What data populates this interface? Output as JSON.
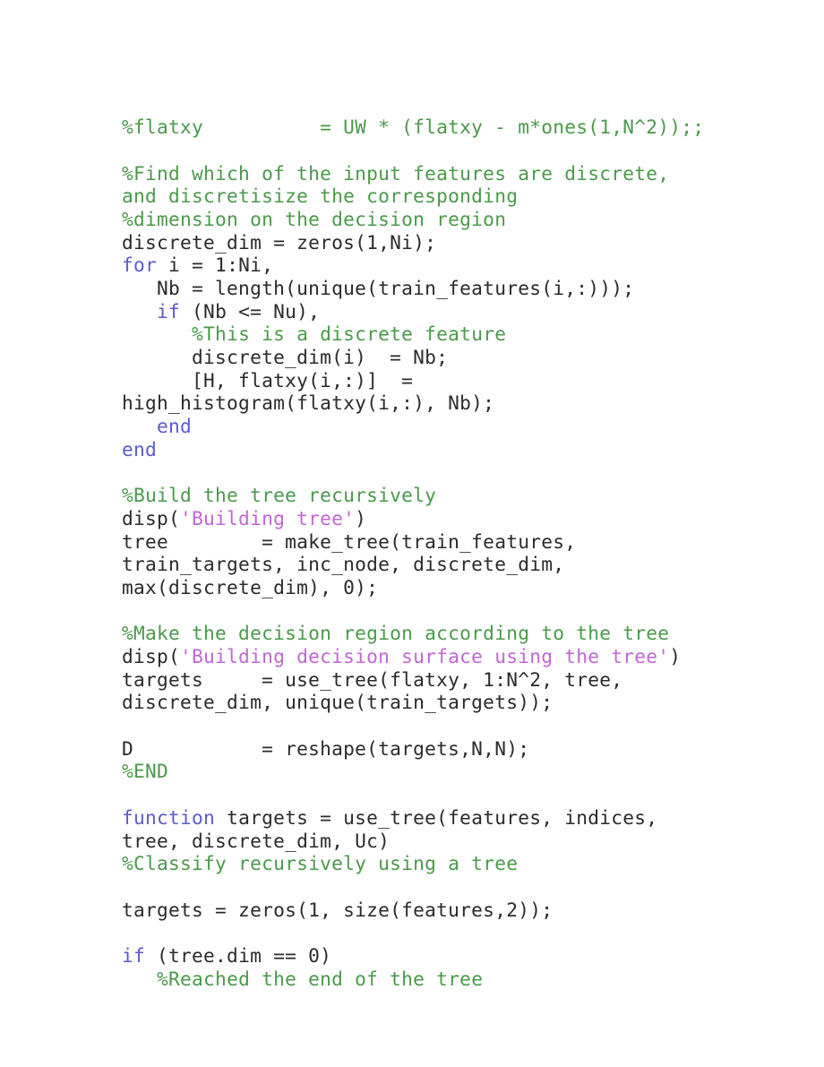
{
  "document": {
    "kind": "source-code-listing",
    "language": "MATLAB",
    "background_color": "#ffffff"
  },
  "theme": {
    "plain_color": "#2b2b2b",
    "comment_color": "#4a9a4a",
    "keyword_color": "#5b5bd0",
    "string_color": "#c266d6"
  },
  "code": {
    "lines": [
      {
        "id": 1,
        "segments": [
          {
            "type": "comment",
            "text": "%flatxy          = UW * (flatxy - m*ones(1,N^2));;"
          }
        ]
      },
      {
        "id": 2,
        "segments": [
          {
            "type": "plain",
            "text": ""
          }
        ]
      },
      {
        "id": 3,
        "segments": [
          {
            "type": "comment",
            "text": "%Find which of the input features are discrete,"
          }
        ]
      },
      {
        "id": 4,
        "segments": [
          {
            "type": "comment",
            "text": "and discretisize the corresponding"
          }
        ]
      },
      {
        "id": 5,
        "segments": [
          {
            "type": "comment",
            "text": "%dimension on the decision region"
          }
        ]
      },
      {
        "id": 6,
        "segments": [
          {
            "type": "plain",
            "text": "discrete_dim = zeros(1,Ni);"
          }
        ]
      },
      {
        "id": 7,
        "segments": [
          {
            "type": "keyword",
            "text": "for"
          },
          {
            "type": "plain",
            "text": " i = 1:Ni,"
          }
        ]
      },
      {
        "id": 8,
        "segments": [
          {
            "type": "plain",
            "text": "   Nb = length(unique(train_features(i,:)));"
          }
        ]
      },
      {
        "id": 9,
        "segments": [
          {
            "type": "plain",
            "text": "   "
          },
          {
            "type": "keyword",
            "text": "if"
          },
          {
            "type": "plain",
            "text": " (Nb <= Nu),"
          }
        ]
      },
      {
        "id": 10,
        "segments": [
          {
            "type": "plain",
            "text": "      "
          },
          {
            "type": "comment",
            "text": "%This is a discrete feature"
          }
        ]
      },
      {
        "id": 11,
        "segments": [
          {
            "type": "plain",
            "text": "      discrete_dim(i)  = Nb;"
          }
        ]
      },
      {
        "id": 12,
        "segments": [
          {
            "type": "plain",
            "text": "      [H, flatxy(i,:)]  ="
          }
        ]
      },
      {
        "id": 13,
        "segments": [
          {
            "type": "plain",
            "text": "high_histogram(flatxy(i,:), Nb);"
          }
        ]
      },
      {
        "id": 14,
        "segments": [
          {
            "type": "plain",
            "text": "   "
          },
          {
            "type": "keyword",
            "text": "end"
          }
        ]
      },
      {
        "id": 15,
        "segments": [
          {
            "type": "keyword",
            "text": "end"
          }
        ]
      },
      {
        "id": 16,
        "segments": [
          {
            "type": "plain",
            "text": ""
          }
        ]
      },
      {
        "id": 17,
        "segments": [
          {
            "type": "comment",
            "text": "%Build the tree recursively"
          }
        ]
      },
      {
        "id": 18,
        "segments": [
          {
            "type": "plain",
            "text": "disp("
          },
          {
            "type": "string",
            "text": "'Building tree'"
          },
          {
            "type": "plain",
            "text": ")"
          }
        ]
      },
      {
        "id": 19,
        "segments": [
          {
            "type": "plain",
            "text": "tree        = make_tree(train_features,"
          }
        ]
      },
      {
        "id": 20,
        "segments": [
          {
            "type": "plain",
            "text": "train_targets, inc_node, discrete_dim,"
          }
        ]
      },
      {
        "id": 21,
        "segments": [
          {
            "type": "plain",
            "text": "max(discrete_dim), 0);"
          }
        ]
      },
      {
        "id": 22,
        "segments": [
          {
            "type": "plain",
            "text": ""
          }
        ]
      },
      {
        "id": 23,
        "segments": [
          {
            "type": "comment",
            "text": "%Make the decision region according to the tree"
          }
        ]
      },
      {
        "id": 24,
        "segments": [
          {
            "type": "plain",
            "text": "disp("
          },
          {
            "type": "string",
            "text": "'Building decision surface using the tree'"
          },
          {
            "type": "plain",
            "text": ")"
          }
        ]
      },
      {
        "id": 25,
        "segments": [
          {
            "type": "plain",
            "text": "targets     = use_tree(flatxy, 1:N^2, tree,"
          }
        ]
      },
      {
        "id": 26,
        "segments": [
          {
            "type": "plain",
            "text": "discrete_dim, unique(train_targets));"
          }
        ]
      },
      {
        "id": 27,
        "segments": [
          {
            "type": "plain",
            "text": ""
          }
        ]
      },
      {
        "id": 28,
        "segments": [
          {
            "type": "plain",
            "text": "D           = reshape(targets,N,N);"
          }
        ]
      },
      {
        "id": 29,
        "segments": [
          {
            "type": "comment",
            "text": "%END"
          }
        ]
      },
      {
        "id": 30,
        "segments": [
          {
            "type": "plain",
            "text": ""
          }
        ]
      },
      {
        "id": 31,
        "segments": [
          {
            "type": "keyword",
            "text": "function"
          },
          {
            "type": "plain",
            "text": " targets = use_tree(features, indices,"
          }
        ]
      },
      {
        "id": 32,
        "segments": [
          {
            "type": "plain",
            "text": "tree, discrete_dim, Uc)"
          }
        ]
      },
      {
        "id": 33,
        "segments": [
          {
            "type": "comment",
            "text": "%Classify recursively using a tree"
          }
        ]
      },
      {
        "id": 34,
        "segments": [
          {
            "type": "plain",
            "text": ""
          }
        ]
      },
      {
        "id": 35,
        "segments": [
          {
            "type": "plain",
            "text": "targets = zeros(1, size(features,2));"
          }
        ]
      },
      {
        "id": 36,
        "segments": [
          {
            "type": "plain",
            "text": ""
          }
        ]
      },
      {
        "id": 37,
        "segments": [
          {
            "type": "keyword",
            "text": "if"
          },
          {
            "type": "plain",
            "text": " (tree.dim == 0)"
          }
        ]
      },
      {
        "id": 38,
        "segments": [
          {
            "type": "plain",
            "text": "   "
          },
          {
            "type": "comment",
            "text": "%Reached the end of the tree"
          }
        ]
      }
    ]
  }
}
